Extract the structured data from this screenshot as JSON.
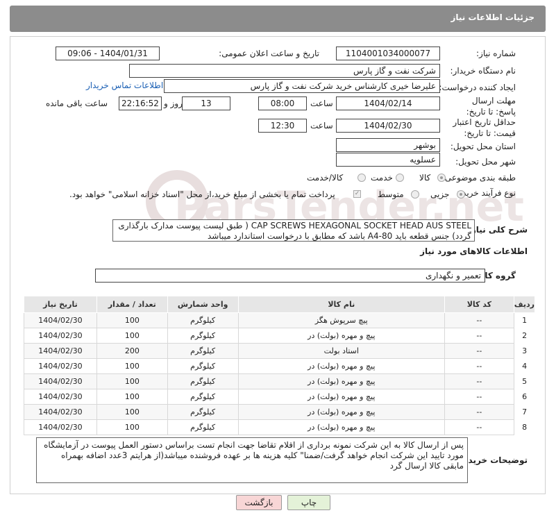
{
  "header": {
    "title": "جزئیات اطلاعات نیاز"
  },
  "fields": {
    "need_number_label": "شماره نیاز:",
    "need_number": "1104001034000077",
    "announce_label": "تاریخ و ساعت اعلان عمومی:",
    "announce_value": "1404/01/31 - 09:06",
    "buyer_org_label": "نام دستگاه خریدار:",
    "buyer_org": "شرکت نفت و گاز پارس",
    "creator_label": "ایجاد کننده درخواست:",
    "creator": "علیرضا  خیری کارشناس خرید  شرکت نفت و گاز پارس",
    "contact_link": "اطلاعات تماس خریدار",
    "reply_deadline_label": "مهلت ارسال پاسخ: تا تاریخ:",
    "reply_date": "1404/02/14",
    "time_label": "ساعت",
    "reply_time": "08:00",
    "days_value": "13",
    "days_label": "روز و",
    "remaining_time": "22:16:52",
    "remaining_label": "ساعت باقی مانده",
    "price_deadline_label": "حداقل تاریخ اعتبار قیمت: تا تاریخ:",
    "price_date": "1404/02/30",
    "price_time": "12:30",
    "province_label": "استان محل تحویل:",
    "province": "بوشهر",
    "city_label": "شهر محل تحویل:",
    "city": "عسلویه",
    "category_label": "طبقه بندی موضوعی:",
    "category_options": [
      "کالا",
      "خدمت",
      "کالا/خدمت"
    ],
    "process_label": "نوع فرآیند خرید :",
    "process_options": [
      "جزیی",
      "متوسط"
    ],
    "payment_note": "پرداخت تمام یا بخشی از مبلغ خرید،از محل \"اسناد خزانه اسلامی\" خواهد بود.",
    "desc_label": "شرح کلی نیاز:",
    "desc_text": "CAP SCREWS HEXAGONAL SOCKET HEAD AUS STEEL ( طبق لیست پیوست مدارک بارگذاری گردد) جنس قطعه باید A4-80 باشد که مطابق با درخواست استاندارد میباشد",
    "goods_info_title": "اطلاعات کالاهای مورد نیاز",
    "goods_group_label": "گروه کالا:",
    "goods_group": "تعمیر و نگهداری"
  },
  "table": {
    "headers": [
      "ردیف",
      "کد کالا",
      "نام کالا",
      "واحد شمارش",
      "تعداد / مقدار",
      "تاریخ نیاز"
    ],
    "rows": [
      [
        "1",
        "--",
        "پیچ سرپوش هگز",
        "کیلوگرم",
        "100",
        "1404/02/30"
      ],
      [
        "2",
        "--",
        "پیچ و مهره (بولت) در",
        "کیلوگرم",
        "100",
        "1404/02/30"
      ],
      [
        "3",
        "--",
        "استاد بولت",
        "کیلوگرم",
        "200",
        "1404/02/30"
      ],
      [
        "4",
        "--",
        "پیچ و مهره (بولت) در",
        "کیلوگرم",
        "100",
        "1404/02/30"
      ],
      [
        "5",
        "--",
        "پیچ و مهره (بولت) در",
        "کیلوگرم",
        "100",
        "1404/02/30"
      ],
      [
        "6",
        "--",
        "پیچ و مهره (بولت) در",
        "کیلوگرم",
        "100",
        "1404/02/30"
      ],
      [
        "7",
        "--",
        "پیچ و مهره (بولت) در",
        "کیلوگرم",
        "100",
        "1404/02/30"
      ],
      [
        "8",
        "--",
        "پیچ و مهره (بولت) در",
        "کیلوگرم",
        "100",
        "1404/02/30"
      ]
    ]
  },
  "notes": {
    "label": "توضیحات خریدار:",
    "text": "پس از ارسال کالا به این شرکت نمونه برداری از اقلام تقاضا جهت انجام تست  براساس دستور العمل پیوست  در آزمایشگاه مورد تایید این شرکت انجام خواهد گرفت/ضمنا\" کلیه هزینه ها بر عهده فروشنده میباشد(از هرایتم 3عدد اضافه بهمراه مابقی کالا ارسال گرد"
  },
  "buttons": {
    "print": "چاپ",
    "back": "بازگشت"
  },
  "watermark": {
    "text": "ParsTender.net"
  }
}
